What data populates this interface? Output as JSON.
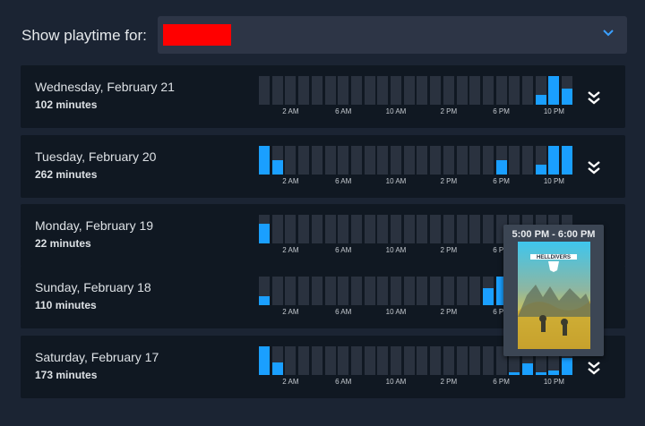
{
  "header": {
    "label": "Show playtime for:",
    "selected_value": ""
  },
  "accent_color": "#1a9fff",
  "axis_ticks": [
    "2 AM",
    "6 AM",
    "10 AM",
    "2 PM",
    "6 PM",
    "10 PM"
  ],
  "days": [
    {
      "date": "Wednesday, February 21",
      "minutes": "102 minutes",
      "hourly_fraction": [
        0,
        0,
        0,
        0,
        0,
        0,
        0,
        0,
        0,
        0,
        0,
        0,
        0,
        0,
        0,
        0,
        0,
        0,
        0,
        0,
        0,
        0.35,
        1,
        0.55
      ]
    },
    {
      "date": "Tuesday, February 20",
      "minutes": "262 minutes",
      "hourly_fraction": [
        1,
        0.5,
        0,
        0,
        0,
        0,
        0,
        0,
        0,
        0,
        0,
        0,
        0,
        0,
        0,
        0,
        0,
        0,
        0.5,
        0,
        0,
        0.35,
        1,
        1
      ]
    },
    {
      "date": "Monday, February 19",
      "minutes": "22 minutes",
      "hourly_fraction": [
        0.7,
        0,
        0,
        0,
        0,
        0,
        0,
        0,
        0,
        0,
        0,
        0,
        0,
        0,
        0,
        0,
        0,
        0,
        0,
        0,
        0,
        0,
        0,
        0
      ]
    },
    {
      "date": "Sunday, February 18",
      "minutes": "110 minutes",
      "hourly_fraction": [
        0.3,
        0,
        0,
        0,
        0,
        0,
        0,
        0,
        0,
        0,
        0,
        0,
        0,
        0,
        0,
        0,
        0,
        0.6,
        1,
        0,
        0,
        0,
        0,
        0
      ]
    },
    {
      "date": "Saturday, February 17",
      "minutes": "173 minutes",
      "hourly_fraction": [
        1,
        0.45,
        0,
        0,
        0,
        0,
        0,
        0,
        0,
        0,
        0,
        0,
        0,
        0,
        0,
        0,
        0,
        0,
        0,
        0.1,
        0.4,
        0.1,
        0.15,
        0.6
      ]
    }
  ],
  "tooltip": {
    "time": "5:00 PM - 6:00 PM",
    "game": "HELLDIVERS"
  }
}
